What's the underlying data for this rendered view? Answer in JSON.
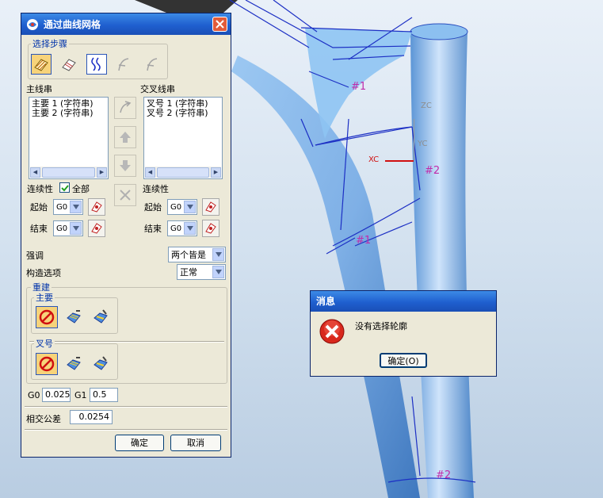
{
  "viewport": {
    "labels": {
      "curve_1": "#1",
      "curve_2": "#2",
      "curve_1b": "#1",
      "curve_2b": "#2",
      "axis_zc": "ZC",
      "axis_yc": "YC",
      "axis_xc": "XC"
    }
  },
  "dialog": {
    "title": "通过曲线网格",
    "steps_group": "选择步骤",
    "primary": {
      "title": "主线串",
      "items": [
        "主要 1 (字符串)",
        "主要 2 (字符串)"
      ],
      "continuity": "连续性",
      "all": "全部",
      "all_checked": true,
      "start": "起始",
      "start_value": "G0",
      "end": "结束",
      "end_value": "G0"
    },
    "cross": {
      "title": "交叉线串",
      "items": [
        "叉号 1 (字符串)",
        "叉号 2 (字符串)"
      ],
      "continuity": "连续性",
      "start": "起始",
      "start_value": "G0",
      "end": "结束",
      "end_value": "G0"
    },
    "emphasis": {
      "label": "强调",
      "value": "两个皆是"
    },
    "construct": {
      "label": "构造选项",
      "value": "正常"
    },
    "rebuild": {
      "title": "重建",
      "primary_title": "主要",
      "cross_title": "叉号"
    },
    "g0": {
      "label": "G0",
      "value": "0.025"
    },
    "g1": {
      "label": "G1",
      "value": "0.5"
    },
    "tolerance": {
      "label": "相交公差",
      "value": "0.0254"
    },
    "ok": "确定",
    "cancel": "取消"
  },
  "message": {
    "title": "消息",
    "text": "没有选择轮廓",
    "ok": "确定(O)"
  },
  "colors": {
    "accent": "#1f5fcf",
    "surface": "#7fb3ea",
    "curve": "#1c2fc4",
    "label": "#c02caa"
  }
}
